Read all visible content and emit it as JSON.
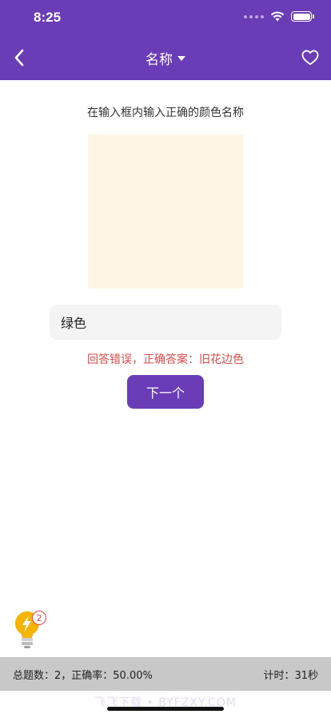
{
  "status_bar": {
    "time": "8:25"
  },
  "nav": {
    "title": "名称"
  },
  "question": {
    "instruction": "在输入框内输入正确的颜色名称",
    "swatch_color": "#FDF5E6"
  },
  "answer": {
    "value": "绿色"
  },
  "result": {
    "message": "回答错误，正确答案：旧花边色"
  },
  "actions": {
    "next_label": "下一个"
  },
  "hint": {
    "count": "2"
  },
  "stats": {
    "summary": "总题数：2，正确率：50.00%",
    "timer": "计时：31秒"
  },
  "watermark": "飞飞下载 • BYFZXY.COM",
  "colors": {
    "primary": "#6A3CB5",
    "error": "#E04A4A",
    "bottom_bar": "#C8C8C8"
  }
}
